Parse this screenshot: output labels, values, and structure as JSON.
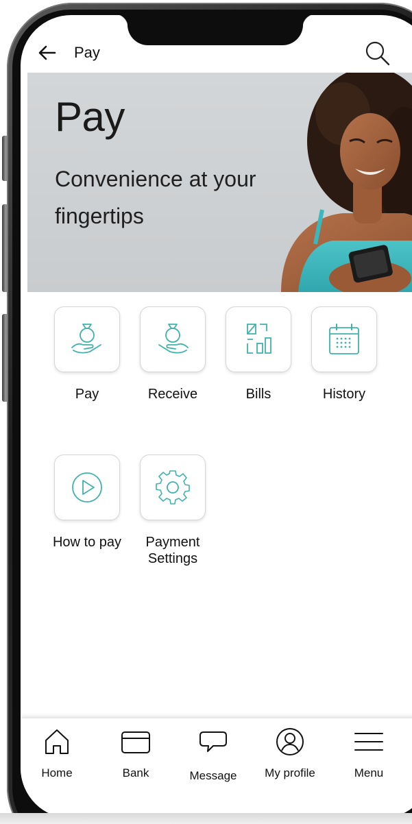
{
  "header": {
    "title": "Pay"
  },
  "banner": {
    "title": "Pay",
    "subtitle": "Convenience at your fingertips"
  },
  "tiles": [
    {
      "label": "Pay",
      "icon": "hand-money-bag-icon"
    },
    {
      "label": "Receive",
      "icon": "receive-money-bag-icon"
    },
    {
      "label": "Bills",
      "icon": "bills-chart-icon"
    },
    {
      "label": "History",
      "icon": "calendar-icon"
    },
    {
      "label": "How to pay",
      "icon": "play-icon"
    },
    {
      "label": "Payment Settings",
      "icon": "gear-icon"
    }
  ],
  "nav": [
    {
      "label": "Home",
      "icon": "home-icon"
    },
    {
      "label": "Bank",
      "icon": "card-icon"
    },
    {
      "label": "Message",
      "icon": "chat-bubble-icon"
    },
    {
      "label": "My profile",
      "icon": "user-circle-icon"
    },
    {
      "label": "Menu",
      "icon": "hamburger-icon"
    }
  ],
  "colors": {
    "accent": "#3fb3aa",
    "tile_border": "#d6d6d6",
    "text": "#111111"
  }
}
